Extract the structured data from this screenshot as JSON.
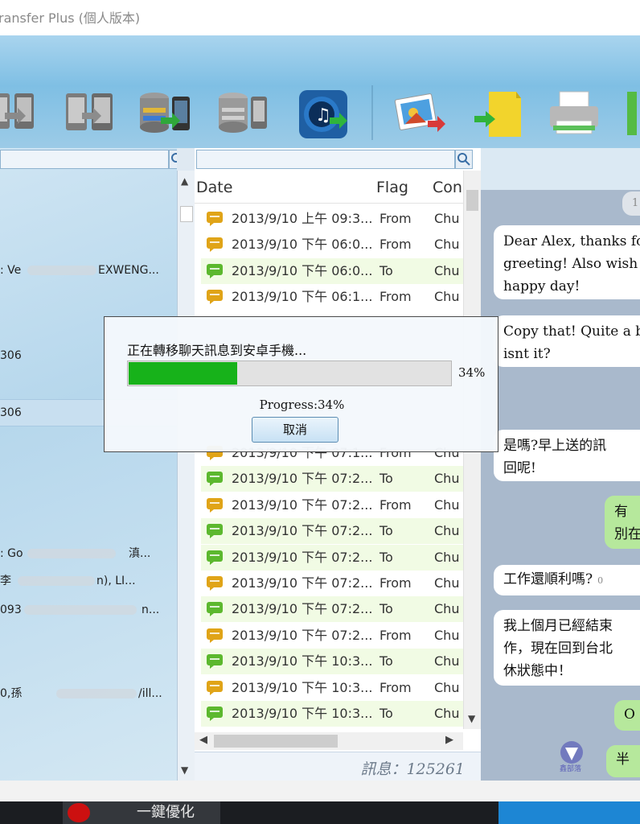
{
  "window": {
    "title": "ransfer Plus (個人版本)"
  },
  "toolbar": {
    "buttons": [
      {
        "name": "phone-transfer"
      },
      {
        "name": "phone-to-phone"
      },
      {
        "name": "backup-to-phone"
      },
      {
        "name": "database-to-phone"
      },
      {
        "name": "itunes-transfer"
      },
      {
        "name": "photo-export"
      },
      {
        "name": "file-export"
      },
      {
        "name": "print"
      }
    ]
  },
  "left_panel": {
    "rows": [
      {
        "text": ": Ve",
        "text2": "EXWENG..."
      },
      {
        "text": "306",
        "text2": ""
      },
      {
        "text": "306",
        "text2": "",
        "selected": true
      },
      {
        "text": ": Go",
        "text2": "滇..."
      },
      {
        "text": "李",
        "text2": "n),   LI..."
      },
      {
        "text": "093",
        "text2": "n..."
      },
      {
        "text": "0,孫",
        "text2": "/ill..."
      }
    ]
  },
  "message_list": {
    "columns": {
      "date": "Date",
      "flag": "Flag",
      "contact": "Con"
    },
    "rows": [
      {
        "date": "2013/9/10 上午 09:3...",
        "flag": "From",
        "contact": "Chu"
      },
      {
        "date": "2013/9/10 下午 06:0...",
        "flag": "From",
        "contact": "Chu"
      },
      {
        "date": "2013/9/10 下午 06:0...",
        "flag": "To",
        "contact": "Chu"
      },
      {
        "date": "2013/9/10 下午 06:1...",
        "flag": "From",
        "contact": "Chu"
      },
      {
        "date": "2013/9/10 下午 07:1...",
        "flag": "From",
        "contact": "Chu"
      },
      {
        "date": "2013/9/10 下午 07:2...",
        "flag": "To",
        "contact": "Chu"
      },
      {
        "date": "2013/9/10 下午 07:2...",
        "flag": "From",
        "contact": "Chu"
      },
      {
        "date": "2013/9/10 下午 07:2...",
        "flag": "To",
        "contact": "Chu"
      },
      {
        "date": "2013/9/10 下午 07:2...",
        "flag": "To",
        "contact": "Chu"
      },
      {
        "date": "2013/9/10 下午 07:2...",
        "flag": "From",
        "contact": "Chu"
      },
      {
        "date": "2013/9/10 下午 07:2...",
        "flag": "To",
        "contact": "Chu"
      },
      {
        "date": "2013/9/10 下午 07:2...",
        "flag": "From",
        "contact": "Chu"
      },
      {
        "date": "2013/9/10 下午 10:3...",
        "flag": "To",
        "contact": "Chu"
      },
      {
        "date": "2013/9/10 下午 10:3...",
        "flag": "From",
        "contact": "Chu"
      },
      {
        "date": "2013/9/10 下午 10:3...",
        "flag": "To",
        "contact": "Chu"
      }
    ],
    "status": "訊息：125261"
  },
  "chat_preview": {
    "header_badge": "1",
    "bubbles": [
      {
        "text": "Dear Alex, thanks fo",
        "side": "left"
      },
      {
        "text": "greeting! Also wish y",
        "side": "left"
      },
      {
        "text": "happy day!",
        "side": "left"
      },
      {
        "text": "Copy that! Quite a b",
        "side": "left"
      },
      {
        "text": "isnt it?",
        "side": "left"
      },
      {
        "text": "是嗎?早上送的訊",
        "side": "left"
      },
      {
        "text": "回呢!",
        "side": "left"
      },
      {
        "text": "有",
        "side": "right"
      },
      {
        "text": "別在",
        "side": "right"
      },
      {
        "text": "工作還順利嗎?",
        "side": "left",
        "time": "0"
      },
      {
        "text": "我上個月已經結束",
        "side": "left"
      },
      {
        "text": "作，現在回到台北",
        "side": "left"
      },
      {
        "text": "休狀態中！",
        "side": "left"
      },
      {
        "text": "O",
        "side": "right"
      },
      {
        "text": "半",
        "side": "right"
      }
    ],
    "watermark": "鑫部落"
  },
  "dialog": {
    "message": "正在轉移聊天訊息到安卓手機...",
    "percent_text": "34%",
    "progress_label": "Progress:34%",
    "progress": 0.34,
    "cancel_label": "取消"
  },
  "taskbar": {
    "app_label": "一鍵優化"
  },
  "colors": {
    "progress_green": "#17b21a",
    "chat_bg": "#a9b9cc",
    "to_row_bg": "#f1fbe4",
    "bubble_green": "#b6e89c"
  }
}
